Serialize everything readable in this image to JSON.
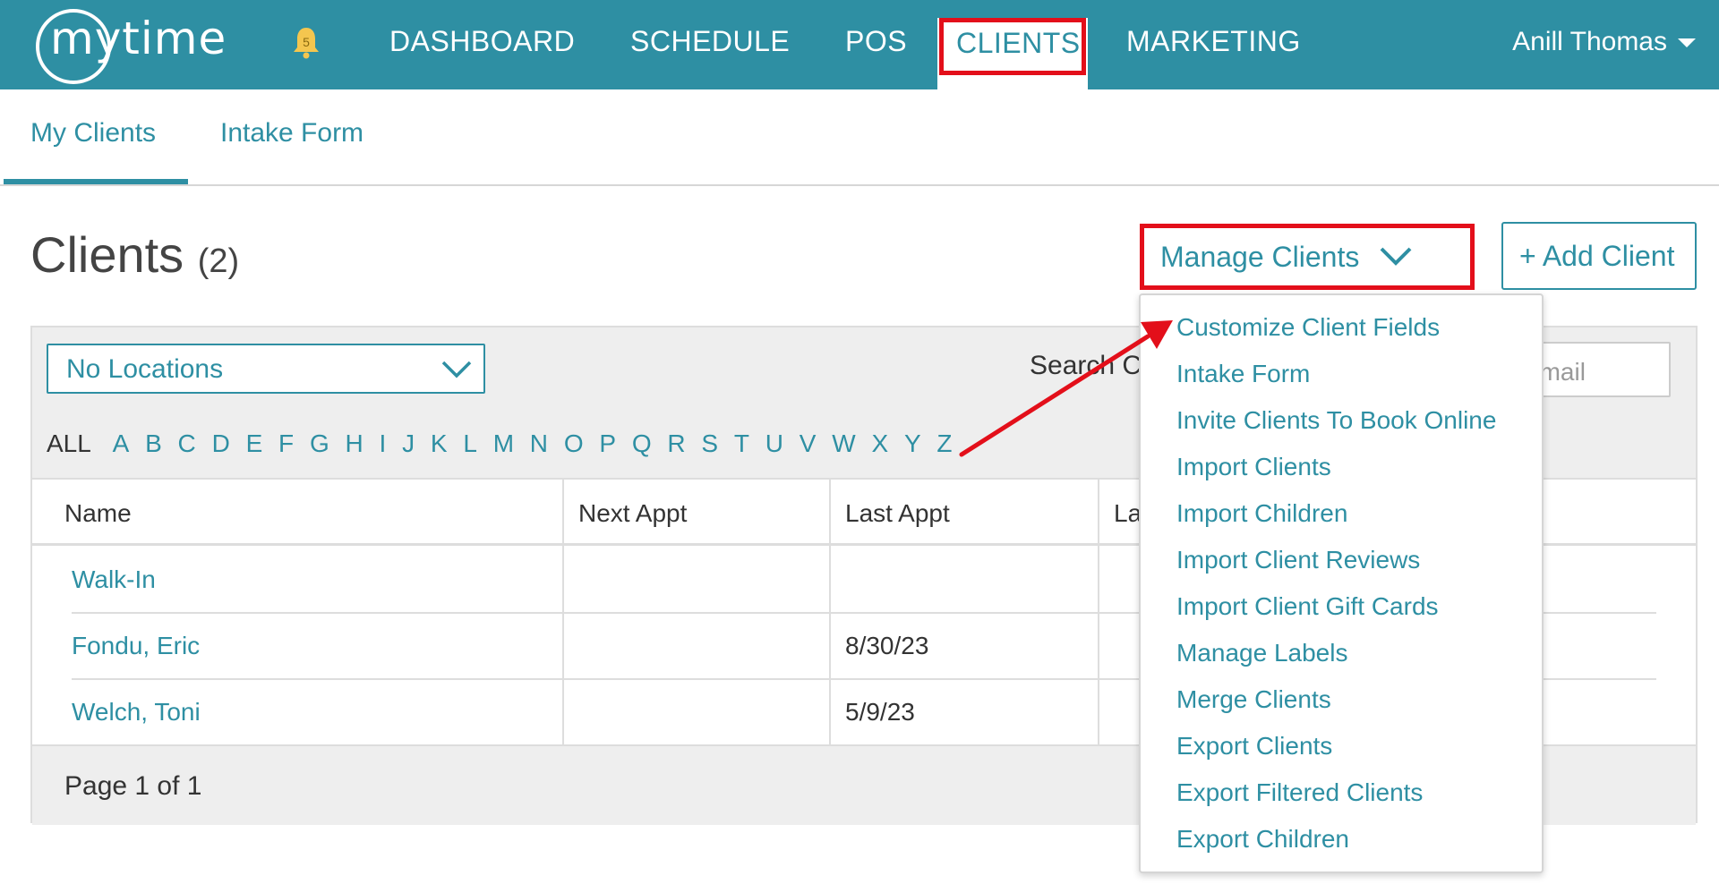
{
  "brand": {
    "logo_text": "mytime",
    "accent": "#2e8fa3",
    "highlight": "#e30f1a"
  },
  "topnav": {
    "bell_count": "5",
    "items": [
      "DASHBOARD",
      "SCHEDULE",
      "POS",
      "CLIENTS",
      "MARKETING"
    ],
    "active": "CLIENTS",
    "user_name": "Anill Thomas"
  },
  "subtabs": [
    "My Clients",
    "Intake Form"
  ],
  "header": {
    "title": "Clients",
    "count": "(2)",
    "manage_label": "Manage Clients",
    "add_label": "+ Add Client"
  },
  "filters": {
    "location": "No Locations",
    "search_label": "Search C",
    "search_placeholder": "email",
    "alpha_all": "ALL",
    "alphabet": [
      "A",
      "B",
      "C",
      "D",
      "E",
      "F",
      "G",
      "H",
      "I",
      "J",
      "K",
      "L",
      "M",
      "N",
      "O",
      "P",
      "Q",
      "R",
      "S",
      "T",
      "U",
      "V",
      "W",
      "X",
      "Y",
      "Z"
    ]
  },
  "table": {
    "columns": [
      "Name",
      "Next Appt",
      "Last Appt",
      "La"
    ],
    "rows": [
      {
        "name": "Walk-In",
        "next": "",
        "last": ""
      },
      {
        "name": "Fondu, Eric",
        "next": "",
        "last": "8/30/23"
      },
      {
        "name": "Welch, Toni",
        "next": "",
        "last": "5/9/23"
      }
    ],
    "pager": "Page 1 of 1"
  },
  "menu": {
    "items": [
      "Customize Client Fields",
      "Intake Form",
      "Invite Clients To Book Online",
      "Import Clients",
      "Import Children",
      "Import Client Reviews",
      "Import Client Gift Cards",
      "Manage Labels",
      "Merge Clients",
      "Export Clients",
      "Export Filtered Clients",
      "Export Children"
    ]
  }
}
